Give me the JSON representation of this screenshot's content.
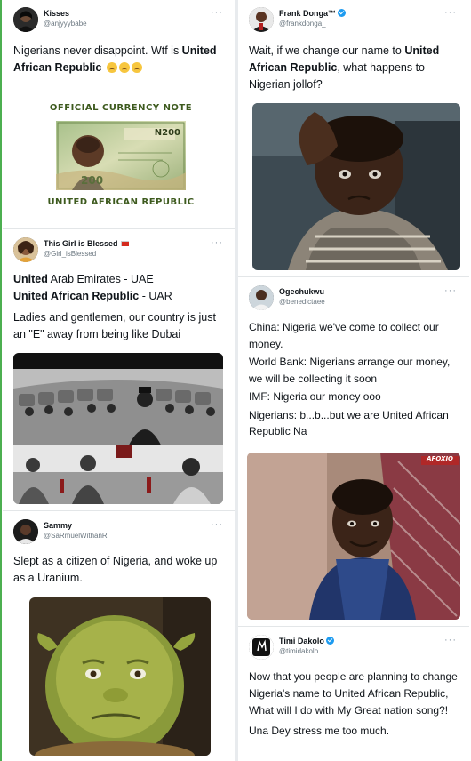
{
  "tweets": {
    "t1": {
      "name": "Kisses",
      "handle": "@anjyyybabe",
      "more": "···",
      "text_plain": "Nigerians never disappoint. Wtf is ",
      "text_bold": "United African Republic",
      "emoji": [
        "disappointed-relieved-emoji",
        "disappointed-relieved-emoji",
        "disappointed-relieved-emoji"
      ],
      "image": {
        "top_caption": "OFFICIAL CURRENCY NOTE",
        "bottom_caption": "UNITED AFRICAN REPUBLIC",
        "note_label": "N200",
        "note_value": "200"
      }
    },
    "t2": {
      "name": "This Girl is Blessed",
      "flag": "canada-flag-icon",
      "handle": "@Girl_isBlessed",
      "more": "···",
      "line1_bold": "United",
      "line1_rest": " Arab Emirates - UAE",
      "line2_bold": "United African Republic",
      "line2_rest": " - UAR",
      "line3": "Ladies and gentlemen, our country is just an \"E\" away from being like Dubai"
    },
    "t3": {
      "name": "Sammy",
      "handle": "@SaRmuelWithanR",
      "more": "···",
      "text": "Slept as a citizen of Nigeria, and woke up as a Uranium."
    },
    "t4": {
      "name": "Frank Donga™",
      "handle": "@frankdonga_",
      "more": "···",
      "text_plain_1": "Wait, if we change our name to ",
      "text_bold": "United African Republic",
      "text_plain_2": ", what happens to Nigerian jollof?"
    },
    "t5": {
      "name": "Ogechukwu",
      "handle": "@benedictaee",
      "more": "···",
      "p1": "China: Nigeria we've come to collect our money.",
      "p2": "World Bank: Nigerians arrange our money, we will be collecting it soon",
      "p3": "IMF: Nigeria our money ooo",
      "p4": "Nigerians: b...b...but we are United African Republic Na",
      "watermark": "AFOXIO"
    },
    "t6": {
      "name": "Timi Dakolo",
      "handle": "@timidakolo",
      "more": "···",
      "p1": "Now that you people are planning  to change Nigeria's name to United African Republic, What will I do with My Great nation song?!",
      "p2": "Una Dey stress me too much."
    }
  },
  "colors": {
    "accent_green": "#4caf50",
    "verified_blue": "#1d9bf0",
    "text": "#0f1419",
    "handle_gray": "#6b7780",
    "caption_green": "#3d5a1e"
  }
}
